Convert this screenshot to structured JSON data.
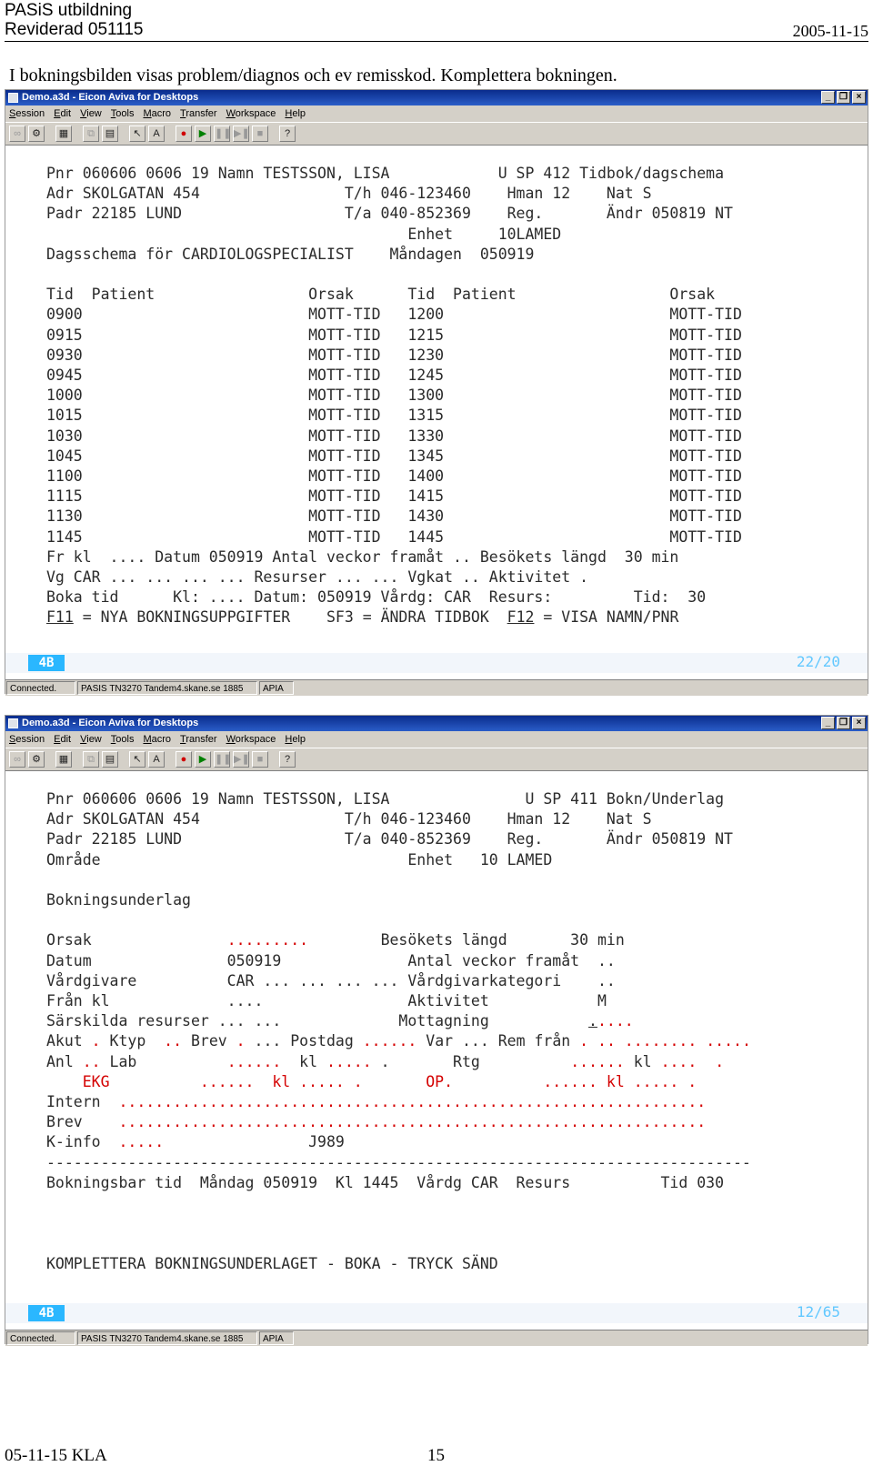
{
  "header": {
    "line1": "PASiS utbildning",
    "line2": "Reviderad 051115",
    "date": "2005-11-15"
  },
  "intro": "I bokningsbilden visas problem/diagnos och ev remisskod. Komplettera bokningen.",
  "window_chrome": {
    "title": "Demo.a3d - Eicon Aviva for Desktops",
    "menus": [
      "Session",
      "Edit",
      "View",
      "Tools",
      "Macro",
      "Transfer",
      "Workspace",
      "Help"
    ],
    "status": {
      "connected": "Connected.",
      "session": "PASIS  TN3270  Tandem4.skane.se  1885",
      "mode": "APIA"
    },
    "indicator": "4B"
  },
  "screen1": {
    "cursor_pos": "22/20",
    "lines": [
      "Pnr 060606 0606 19 Namn TESTSSON, LISA            U SP 412 Tidbok/dagschema",
      "Adr SKOLGATAN 454                T/h 046-123460    Hman 12    Nat S",
      "Padr 22185 LUND                  T/a 040-852369    Reg.       Ändr 050819 NT",
      "                                        Enhet     10LAMED",
      "Dagsschema för CARDIOLOGSPECIALIST    Måndagen  050919",
      "",
      "Tid  Patient                 Orsak      Tid  Patient                 Orsak",
      "0900                         MOTT-TID   1200                         MOTT-TID",
      "0915                         MOTT-TID   1215                         MOTT-TID",
      "0930                         MOTT-TID   1230                         MOTT-TID",
      "0945                         MOTT-TID   1245                         MOTT-TID",
      "1000                         MOTT-TID   1300                         MOTT-TID",
      "1015                         MOTT-TID   1315                         MOTT-TID",
      "1030                         MOTT-TID   1330                         MOTT-TID",
      "1045                         MOTT-TID   1345                         MOTT-TID",
      "1100                         MOTT-TID   1400                         MOTT-TID",
      "1115                         MOTT-TID   1415                         MOTT-TID",
      "1130                         MOTT-TID   1430                         MOTT-TID",
      "1145                         MOTT-TID   1445                         MOTT-TID",
      "Fr kl  .... Datum 050919 Antal veckor framåt .. Besökets längd  30 min",
      "Vg CAR ... ... ... ... Resurser ... ... Vgkat .. Aktivitet .",
      "Boka tid      Kl: .... Datum: 050919 Vårdg: CAR  Resurs:         Tid:  30"
    ],
    "fkeys": {
      "f11": "F11",
      "f11_text": " = NYA BOKNINGSUPPGIFTER    SF3 = ÄNDRA TIDBOK  ",
      "f12": "F12",
      "f12_text": " = VISA NAMN/PNR"
    }
  },
  "screen2": {
    "cursor_pos": "12/65",
    "lines": [
      {
        "t": "Pnr 060606 0606 19 Namn TESTSSON, LISA               U SP 411 Bokn/Underlag"
      },
      {
        "t": "Adr SKOLGATAN 454                T/h 046-123460    Hman 12    Nat S"
      },
      {
        "t": "Padr 22185 LUND                  T/a 040-852369    Reg.       Ändr 050819 NT"
      },
      {
        "t": "Område                                  Enhet   10 LAMED"
      },
      {
        "t": ""
      },
      {
        "t": "Bokningsunderlag"
      },
      {
        "t": ""
      },
      {
        "parts": [
          [
            "Orsak               ",
            ""
          ],
          [
            ".........",
            "red"
          ],
          [
            "        Besökets längd       30 min",
            ""
          ]
        ]
      },
      {
        "t": "Datum               050919              Antal veckor framåt  .."
      },
      {
        "t": "Vårdgivare          CAR ... ... ... ... Vårdgivarkategori    .."
      },
      {
        "t": "Från kl             ....                Aktivitet            M"
      },
      {
        "parts": [
          [
            "Särskilda resurser ... ...             Mottagning           ",
            ""
          ],
          [
            ".",
            "u"
          ],
          [
            "....",
            "red"
          ]
        ]
      },
      {
        "parts": [
          [
            "Akut ",
            ""
          ],
          [
            ".",
            "red"
          ],
          [
            " Ktyp  ",
            ""
          ],
          [
            "..",
            "red"
          ],
          [
            " Brev ",
            ""
          ],
          [
            ".",
            "red"
          ],
          [
            " ... Postdag ",
            ""
          ],
          [
            "......",
            "red"
          ],
          [
            " Var ... Rem från ",
            ""
          ],
          [
            ". .. ........ .....",
            "red"
          ]
        ]
      },
      {
        "parts": [
          [
            "Anl ",
            ""
          ],
          [
            "..",
            "red"
          ],
          [
            " Lab          ",
            ""
          ],
          [
            "......",
            "red"
          ],
          [
            "  kl ",
            ""
          ],
          [
            ".....",
            "red"
          ],
          [
            " .       Rtg          ",
            ""
          ],
          [
            "......",
            "red"
          ],
          [
            " kl ",
            ""
          ],
          [
            "....",
            "red"
          ],
          [
            "  ",
            ""
          ],
          [
            ".",
            "red"
          ]
        ]
      },
      {
        "parts": [
          [
            "    EKG          ......  kl ..... .       OP.          ...... kl ..... .",
            "red"
          ]
        ]
      },
      {
        "parts": [
          [
            "Intern  ",
            ""
          ],
          [
            ".................................................................",
            "red"
          ]
        ]
      },
      {
        "parts": [
          [
            "Brev    ",
            ""
          ],
          [
            ".................................................................",
            "red"
          ]
        ]
      },
      {
        "parts": [
          [
            "K-info  ",
            ""
          ],
          [
            ".....",
            "red"
          ],
          [
            "                J989",
            ""
          ]
        ]
      },
      {
        "t": "------------------------------------------------------------------------------"
      },
      {
        "t": "Bokningsbar tid  Måndag 050919  Kl 1445  Vårdg CAR  Resurs          Tid 030"
      },
      {
        "t": ""
      },
      {
        "t": ""
      },
      {
        "t": ""
      },
      {
        "t": "KOMPLETTERA BOKNINGSUNDERLAGET - BOKA - TRYCK SÄND"
      }
    ]
  },
  "footer": {
    "left": "05-11-15 KLA",
    "page": "15"
  }
}
